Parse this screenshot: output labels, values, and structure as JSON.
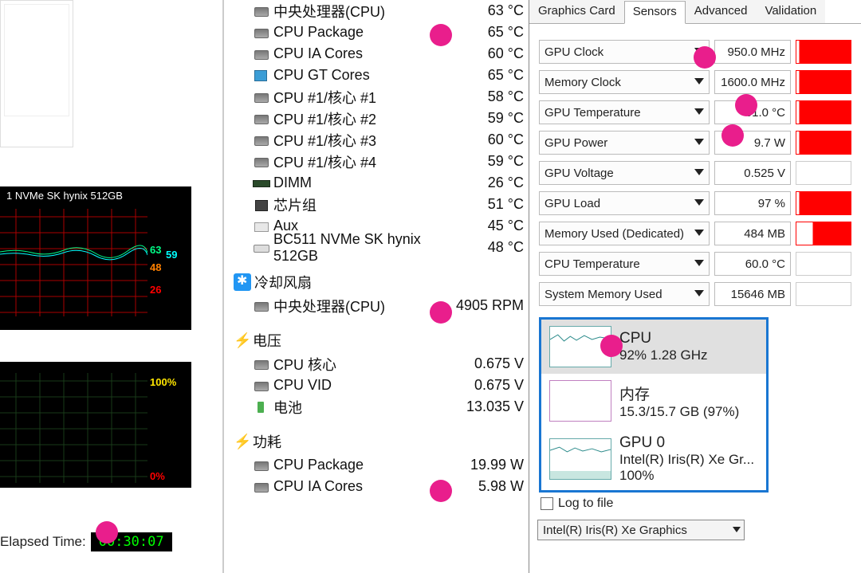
{
  "left": {
    "ssd_label": "1 NVMe SK hynix 512GB",
    "graph1_legend": {
      "a": "63",
      "b": "59",
      "c": "48",
      "d": "26"
    },
    "graph2_top": "100%",
    "graph2_bottom": "0%",
    "elapsed_label": "Elapsed Time:",
    "elapsed_value": "00:30:07"
  },
  "tree": {
    "cpu_temp_rows": [
      {
        "icon": "chip",
        "label": "中央处理器(CPU)",
        "value": "63 °C"
      },
      {
        "icon": "chip",
        "label": "CPU Package",
        "value": "65 °C"
      },
      {
        "icon": "chip",
        "label": "CPU IA Cores",
        "value": "60 °C"
      },
      {
        "icon": "gt",
        "label": "CPU GT Cores",
        "value": "65 °C"
      },
      {
        "icon": "chip",
        "label": "CPU #1/核心 #1",
        "value": "58 °C"
      },
      {
        "icon": "chip",
        "label": "CPU #1/核心 #2",
        "value": "59 °C"
      },
      {
        "icon": "chip",
        "label": "CPU #1/核心 #3",
        "value": "60 °C"
      },
      {
        "icon": "chip",
        "label": "CPU #1/核心 #4",
        "value": "59 °C"
      },
      {
        "icon": "dimm",
        "label": "DIMM",
        "value": "26 °C"
      },
      {
        "icon": "chipset",
        "label": "芯片组",
        "value": "51 °C"
      },
      {
        "icon": "aux",
        "label": "Aux",
        "value": "45 °C"
      },
      {
        "icon": "ssd",
        "label": "BC511 NVMe SK hynix 512GB",
        "value": "48 °C"
      }
    ],
    "fan_header": "冷却风扇",
    "fan_rows": [
      {
        "icon": "chip",
        "label": "中央处理器(CPU)",
        "value": "4905 RPM"
      }
    ],
    "volt_header": "电压",
    "volt_rows": [
      {
        "icon": "chip",
        "label": "CPU 核心",
        "value": "0.675 V"
      },
      {
        "icon": "chip",
        "label": "CPU VID",
        "value": "0.675 V"
      },
      {
        "icon": "batt",
        "label": "电池",
        "value": "13.035 V"
      }
    ],
    "pwr_header": "功耗",
    "pwr_rows": [
      {
        "icon": "chip",
        "label": "CPU Package",
        "value": "19.99 W"
      },
      {
        "icon": "chip",
        "label": "CPU IA Cores",
        "value": "5.98 W"
      }
    ]
  },
  "right": {
    "tabs": [
      "Graphics Card",
      "Sensors",
      "Advanced",
      "Validation"
    ],
    "active_tab": 1,
    "sensors": [
      {
        "name": "GPU Clock",
        "value": "950.0 MHz",
        "graph": "full"
      },
      {
        "name": "Memory Clock",
        "value": "1600.0 MHz",
        "graph": "full"
      },
      {
        "name": "GPU Temperature",
        "value": "61.0 °C",
        "graph": "full"
      },
      {
        "name": "GPU Power",
        "value": "9.7 W",
        "graph": "full"
      },
      {
        "name": "GPU Voltage",
        "value": "0.525 V",
        "graph": "none"
      },
      {
        "name": "GPU Load",
        "value": "97 %",
        "graph": "full"
      },
      {
        "name": "Memory Used (Dedicated)",
        "value": "484 MB",
        "graph": "partial"
      },
      {
        "name": "CPU Temperature",
        "value": "60.0 °C",
        "graph": "none"
      },
      {
        "name": "System Memory Used",
        "value": "15646 MB",
        "graph": "none"
      }
    ],
    "perf": {
      "cpu": {
        "title": "CPU",
        "sub": "92%  1.28 GHz"
      },
      "mem": {
        "title": "内存",
        "sub": "15.3/15.7 GB (97%)"
      },
      "gpu": {
        "title": "GPU 0",
        "sub": "Intel(R) Iris(R) Xe Gr...",
        "extra": "100%"
      }
    },
    "log_label": "Log to file",
    "gpu_combo": "Intel(R) Iris(R) Xe Graphics"
  },
  "annotation_color": "#e91e8c"
}
